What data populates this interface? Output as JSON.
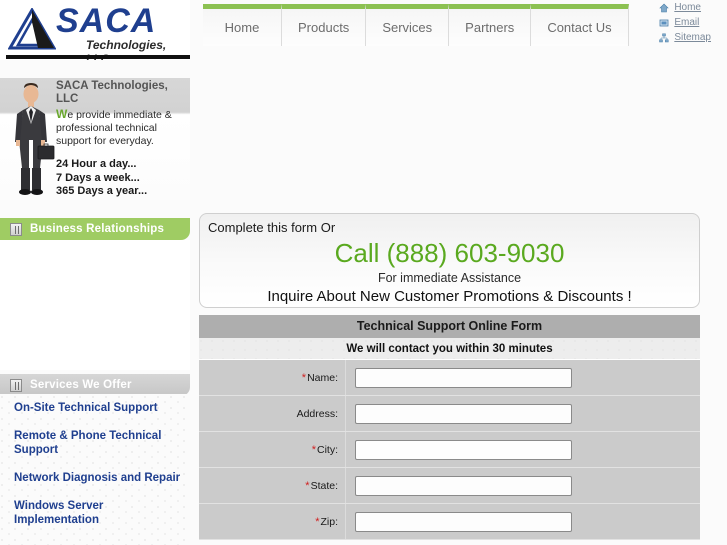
{
  "brand": {
    "name": "SACA",
    "tagline": "Technologies, LLC",
    "logo_icon": "triangle-logo-icon"
  },
  "nav": {
    "items": [
      {
        "label": "Home"
      },
      {
        "label": "Products"
      },
      {
        "label": "Services"
      },
      {
        "label": "Partners"
      },
      {
        "label": "Contact Us"
      }
    ]
  },
  "toplinks": [
    {
      "label": "Home",
      "icon": "home-icon"
    },
    {
      "label": "Email",
      "icon": "email-icon"
    },
    {
      "label": "Sitemap",
      "icon": "sitemap-icon"
    }
  ],
  "hero": {
    "title": "SACA Technologies, LLC",
    "intro_cap": "W",
    "intro_rest": "e provide immediate & professional technical support for everyday.",
    "bullets": [
      "24 Hour a day...",
      "7 Days a week...",
      "365 Days a year..."
    ],
    "photo_alt": "businessman-photo"
  },
  "sidebar": {
    "panels": [
      {
        "title": "Business Relationships",
        "style": "green",
        "items": []
      },
      {
        "title": "Services We Offer",
        "style": "gray",
        "items": [
          {
            "label": "On-Site Technical Support"
          },
          {
            "label": "Remote & Phone Technical Support"
          },
          {
            "label": "Network Diagnosis and Repair"
          },
          {
            "label": "Windows Server Implementation"
          }
        ]
      }
    ]
  },
  "callout": {
    "line1": "Complete this form Or",
    "phone": "Call (888) 603-9030",
    "line3": "For immediate Assistance",
    "line4": "Inquire About New Customer Promotions & Discounts !"
  },
  "form": {
    "title": "Technical Support Online Form",
    "subtitle": "We will contact you within 30 minutes",
    "fields": [
      {
        "label": "Name:",
        "required": true,
        "value": ""
      },
      {
        "label": "Address:",
        "required": false,
        "value": ""
      },
      {
        "label": "City:",
        "required": true,
        "value": ""
      },
      {
        "label": "State:",
        "required": true,
        "value": ""
      },
      {
        "label": "Zip:",
        "required": true,
        "value": ""
      }
    ]
  },
  "colors": {
    "accent_green": "#8cc152",
    "panel_green": "#9fcc63",
    "phone_green": "#5aa91f",
    "link_blue": "#1f3f8f",
    "required_red": "#d02020"
  }
}
